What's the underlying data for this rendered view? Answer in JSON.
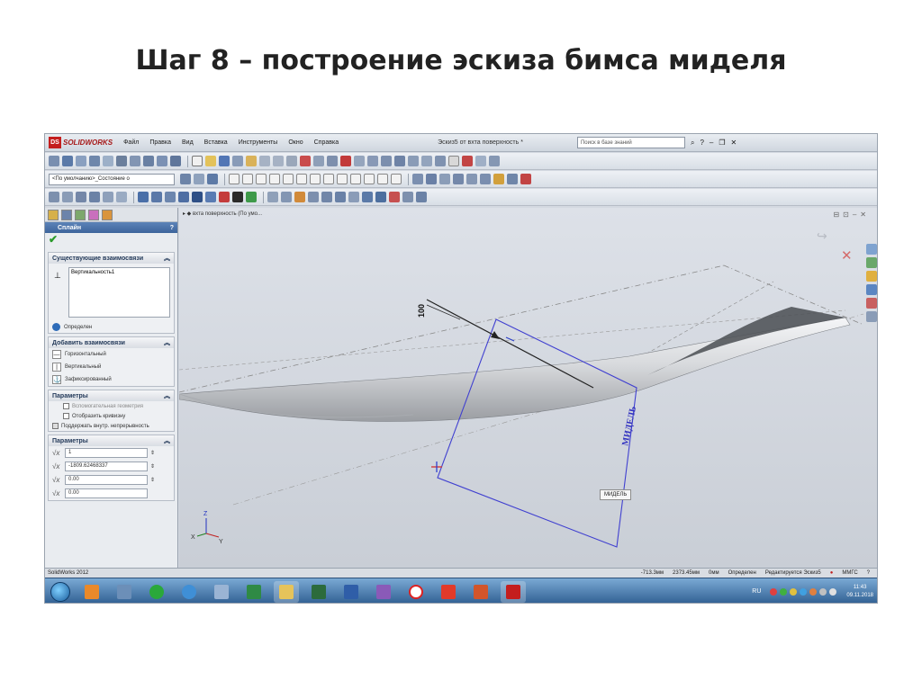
{
  "slide": {
    "title": "Шаг 8 – построение эскиза бимса миделя"
  },
  "app": {
    "logo": "SOLIDWORKS",
    "menu": [
      "Файл",
      "Правка",
      "Вид",
      "Вставка",
      "Инструменты",
      "Окно",
      "Справка"
    ],
    "document_title": "Эскиз5 от вхта поверхность *",
    "search_placeholder": "Поиск в базе знаний"
  },
  "toolbar": {
    "config_select": "<По умолчанию>_Состояние о"
  },
  "panel": {
    "header": "Сплайн",
    "help_label": "?",
    "existing_relations": {
      "title": "Существующие взаимосвязи",
      "items": [
        "Вертикальность1"
      ],
      "status": "Определен"
    },
    "add_relations": {
      "title": "Добавить взаимосвязи",
      "items": [
        "Горизонтальный",
        "Вертикальный",
        "Зафиксированный"
      ]
    },
    "options": {
      "title": "Параметры",
      "checkboxes": [
        "Вспомогательная геометрия",
        "Отобразить кривизну",
        "Поддержать внутр. непрерывность"
      ]
    },
    "parameters": {
      "title": "Параметры",
      "values": [
        "1",
        "-1809.62468337",
        "0.00",
        "0.00"
      ]
    }
  },
  "viewport": {
    "tab_label": "вхта поверхность (По умо...",
    "dimension": "100",
    "plane_label": "МИДЕЛЬ",
    "tag": "МИДЕЛЬ",
    "triad": {
      "x": "X",
      "y": "Y",
      "z": "Z"
    }
  },
  "status": {
    "app_name": "SolidWorks 2012",
    "x": "-713.3мм",
    "y": "2373.45мм",
    "z": "0мм",
    "state": "Определен",
    "editing": "Редактируется Эскиз5",
    "units": "ММГС"
  },
  "taskbar": {
    "lang": "RU",
    "time": "11:43",
    "date": "09.11.2018"
  },
  "colors": {
    "plane_edge": "#4040d0",
    "titlebar": "#cfd6df",
    "taskbar": "#2f5e91",
    "logo_red": "#c41e1e"
  }
}
